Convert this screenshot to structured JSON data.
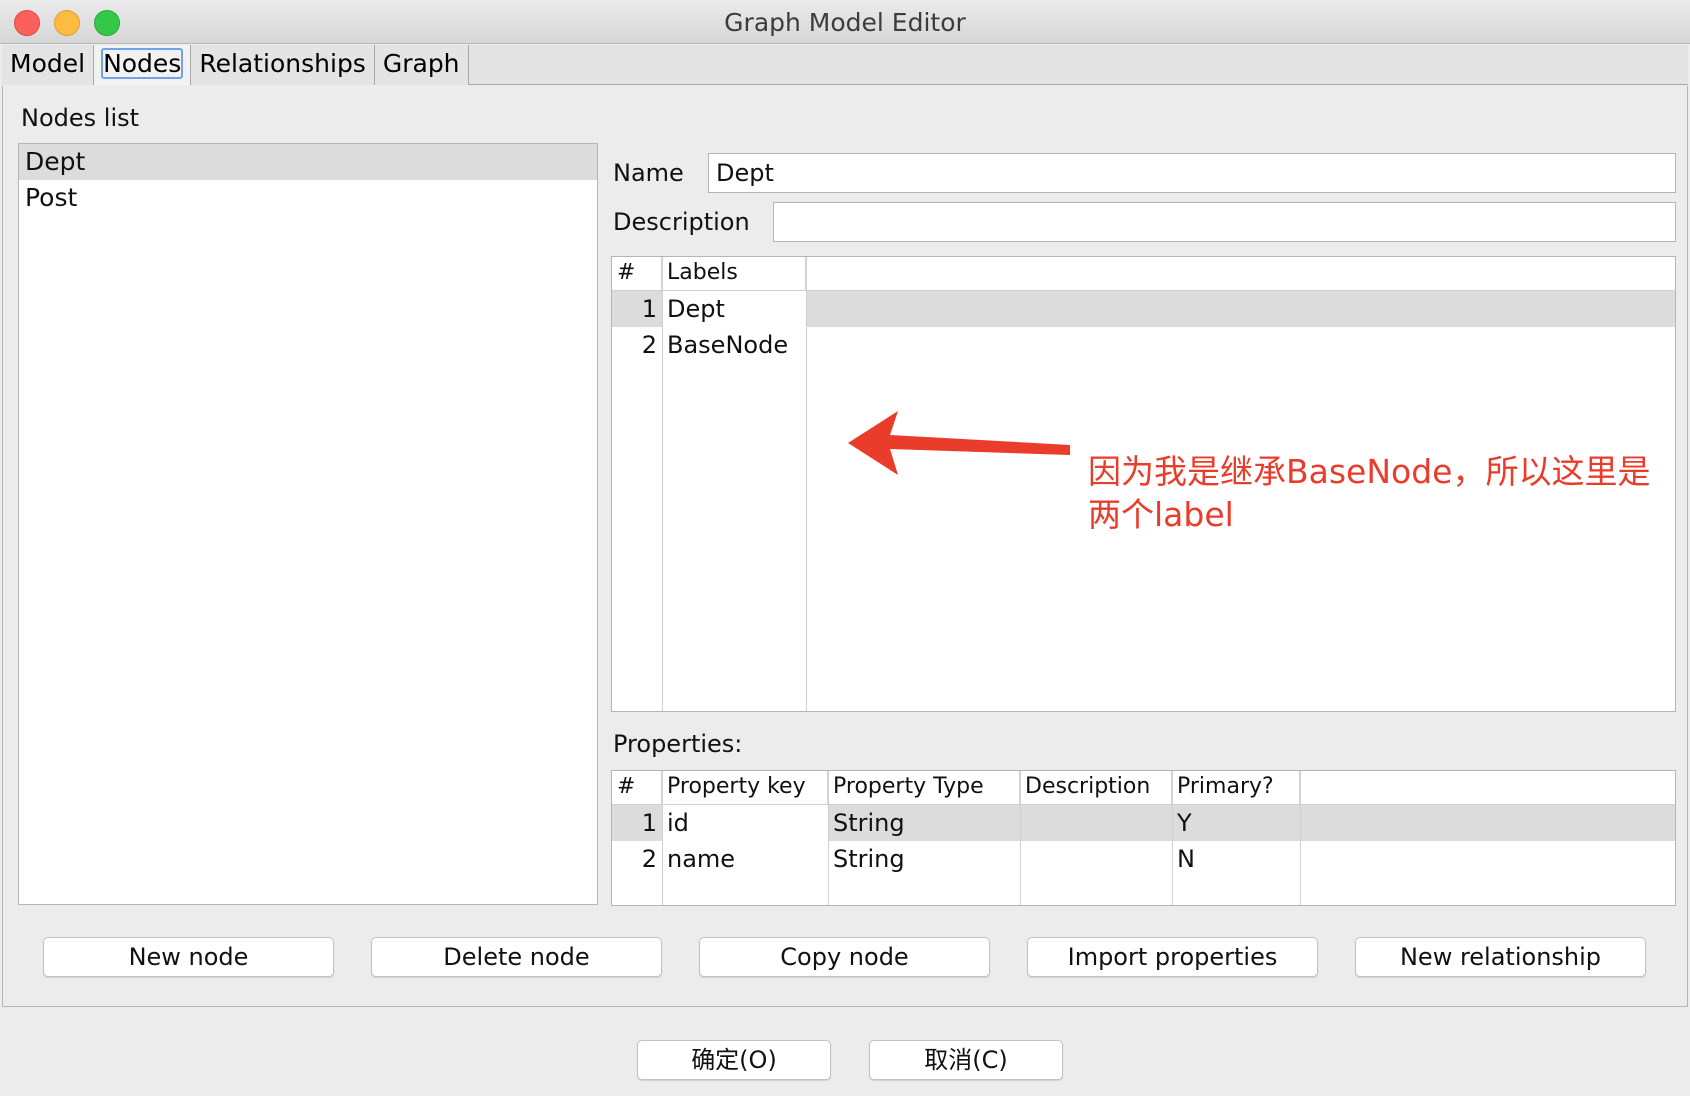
{
  "window": {
    "title": "Graph Model Editor"
  },
  "tabs": [
    {
      "label": "Model"
    },
    {
      "label": "Nodes"
    },
    {
      "label": "Relationships"
    },
    {
      "label": "Graph"
    }
  ],
  "nodes_panel": {
    "label": "Nodes list",
    "items": [
      {
        "label": "Dept"
      },
      {
        "label": "Post"
      }
    ]
  },
  "form": {
    "name_label": "Name",
    "name_value": "Dept",
    "description_label": "Description",
    "description_value": ""
  },
  "labels_table": {
    "headers": [
      "#",
      "Labels"
    ],
    "rows": [
      {
        "num": "1",
        "label": "Dept"
      },
      {
        "num": "2",
        "label": "BaseNode"
      }
    ]
  },
  "properties": {
    "label": "Properties:",
    "headers": [
      "#",
      "Property key",
      "Property Type",
      "Description",
      "Primary?"
    ],
    "rows": [
      {
        "num": "1",
        "key": "id",
        "type": "String",
        "description": "",
        "primary": "Y"
      },
      {
        "num": "2",
        "key": "name",
        "type": "String",
        "description": "",
        "primary": "N"
      }
    ]
  },
  "buttons": {
    "new_node": "New node",
    "delete_node": "Delete node",
    "copy_node": "Copy node",
    "import_properties": "Import properties",
    "new_relationship": "New relationship"
  },
  "dialog_buttons": {
    "ok": "确定(O)",
    "cancel": "取消(C)"
  },
  "annotation": {
    "text": "因为我是继承BaseNode，所以这里是两个label",
    "color": "#ea3c2b"
  }
}
